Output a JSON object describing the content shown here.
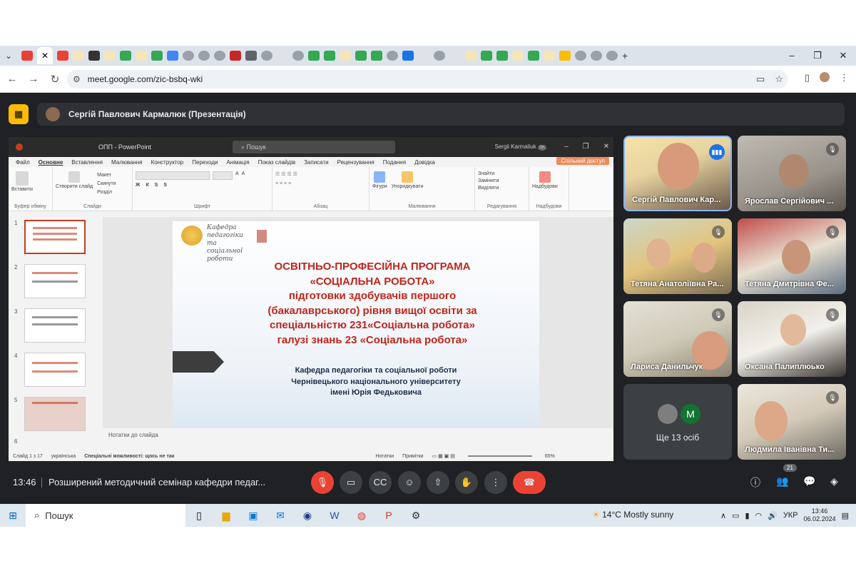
{
  "browser": {
    "url": "meet.google.com/zic-bsbq-wki",
    "window_controls": [
      "–",
      "❐",
      "✕"
    ]
  },
  "meet": {
    "presenter_label": "Сергій Павлович Кармалюк (Презентація)",
    "time": "13:46",
    "meeting_title": "Розширений методичний семінар кафедри педаг...",
    "people_count": "21",
    "participants": [
      {
        "name": "Сергій Павлович Кар...",
        "state": "speaking"
      },
      {
        "name": "Ярослав Сергійович ...",
        "state": "muted"
      },
      {
        "name": "Тетяна Анатоліївна Ра...",
        "state": "muted"
      },
      {
        "name": "Тетяна Дмитрівна Фе...",
        "state": "muted"
      },
      {
        "name": "Лариса Данильчук",
        "state": "muted"
      },
      {
        "name": "Оксана Палиплюько",
        "state": "muted"
      },
      {
        "name": "Людмила Іванівна Ти...",
        "state": "muted"
      }
    ],
    "more_people": {
      "label": "Ще 13 осіб",
      "avatar_letter": "M"
    }
  },
  "powerpoint": {
    "doc_title": "ОПП - PowerPoint",
    "search_placeholder": "Пошук",
    "user": "Sergii Karmaliuk",
    "user_initials": "SK",
    "menu": [
      "Файл",
      "Основне",
      "Вставлення",
      "Малювання",
      "Конструктор",
      "Переходи",
      "Анімація",
      "Показ слайдів",
      "Записати",
      "Рецензування",
      "Подання",
      "Довідка"
    ],
    "share_button": "Спільний доступ",
    "ribbon_groups": [
      "Буфер обміну",
      "Слайди",
      "Шрифт",
      "Абзац",
      "Малювання",
      "Редагування",
      "Надбудови"
    ],
    "ribbon_buttons": {
      "paste": "Вставити",
      "new_slide": "Створити слайд",
      "layout": "Макет",
      "reset": "Скинути",
      "section": "Розділ",
      "shapes": "Фігури",
      "arrange": "Упорядкувати",
      "find": "Знайти",
      "replace": "Замінити",
      "select": "Виділити",
      "addins": "Надбудови"
    },
    "slide_numbers": [
      "1",
      "2",
      "3",
      "4",
      "5",
      "6"
    ],
    "notes_placeholder": "Нотатки до слайда",
    "status": {
      "slide": "Слайд 1 з 17",
      "language": "українська",
      "accessibility": "Спеціальні можливості: щось не так",
      "notes": "Нотатки",
      "comments": "Примітки",
      "zoom": "65%"
    },
    "slide": {
      "logo_text": "Кафедра педагогіки та соціальної роботи",
      "title_lines": [
        "ОСВІТНЬО-ПРОФЕСІЙНА ПРОГРАМА",
        "«СОЦІАЛЬНА РОБОТА»",
        "підготовки здобувачів першого",
        "(бакалаврського) рівня вищої освіти за",
        "спеціальністю 231«Соціальна робота»",
        "галузі знань 23 «Соціальна робота»"
      ],
      "subtitle_lines": [
        "Кафедра педагогіки та соціальної роботи",
        "Чернівецького національного університету",
        "імені Юрія Федьковича"
      ]
    }
  },
  "taskbar": {
    "search": "Пошук",
    "weather": "14°C  Mostly sunny",
    "language": "УКР",
    "clock_time": "13:46",
    "clock_date": "06.02.2024"
  }
}
